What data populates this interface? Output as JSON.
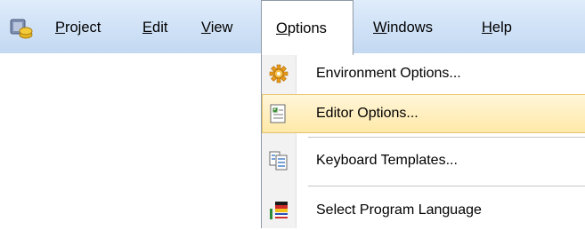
{
  "menubar": {
    "app_icon": "application-icon",
    "items": [
      {
        "accel": "P",
        "rest": "roject"
      },
      {
        "accel": "E",
        "rest": "dit"
      },
      {
        "accel": "V",
        "rest": "iew"
      },
      {
        "accel": "O",
        "rest": "ptions"
      },
      {
        "accel": "W",
        "rest": "indows"
      },
      {
        "accel": "H",
        "rest": "elp"
      }
    ],
    "open_item": "Options"
  },
  "dropdown": {
    "items": [
      {
        "label": "Environment Options...",
        "icon": "environment-options-icon"
      },
      {
        "label": "Editor Options...",
        "icon": "editor-options-icon",
        "highlighted": true
      },
      {
        "label": "Keyboard Templates...",
        "icon": "keyboard-templates-icon"
      },
      {
        "label": "Select Program Language",
        "icon": "program-language-flags-icon"
      }
    ]
  },
  "colors": {
    "menubar_top": "#dfecfb",
    "menubar_bottom": "#c3d8f1",
    "highlight_fill": "#ffe9a8",
    "highlight_border": "#e7c470"
  }
}
